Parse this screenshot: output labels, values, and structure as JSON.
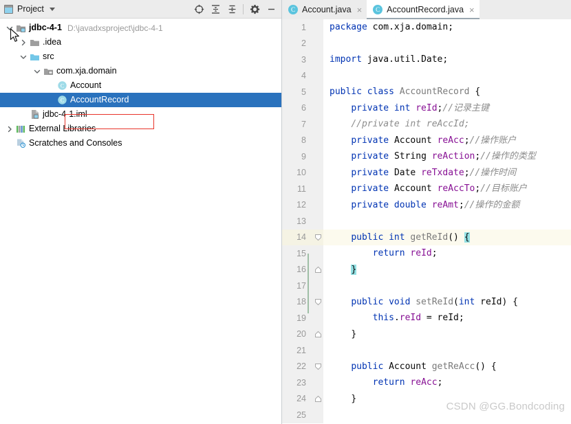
{
  "project_panel": {
    "title": "Project",
    "icons": {
      "project": "project-window-icon",
      "dropdown": "chevron-down-icon",
      "locate": "locate-target-icon",
      "expand_all": "expand-all-icon",
      "collapse_all": "collapse-all-icon",
      "settings": "gear-icon",
      "hide": "minimize-icon"
    },
    "tree": [
      {
        "label": "jdbc-4-1",
        "path": "D:\\javadxsproject\\jdbc-4-1",
        "icon": "module-icon",
        "twisty": "expanded",
        "depth": 0,
        "bold": true,
        "selected": false
      },
      {
        "label": ".idea",
        "path": "",
        "icon": "folder-gray-icon",
        "twisty": "collapsed",
        "depth": 1,
        "bold": false,
        "selected": false
      },
      {
        "label": "src",
        "path": "",
        "icon": "folder-source-icon",
        "twisty": "expanded",
        "depth": 1,
        "bold": false,
        "selected": false
      },
      {
        "label": "com.xja.domain",
        "path": "",
        "icon": "package-icon",
        "twisty": "expanded",
        "depth": 2,
        "bold": false,
        "selected": false
      },
      {
        "label": "Account",
        "path": "",
        "icon": "java-class-icon",
        "twisty": "none",
        "depth": 3,
        "bold": false,
        "selected": false
      },
      {
        "label": "AccountRecord",
        "path": "",
        "icon": "java-class-icon",
        "twisty": "none",
        "depth": 3,
        "bold": false,
        "selected": true
      },
      {
        "label": "jdbc-4-1.iml",
        "path": "",
        "icon": "iml-file-icon",
        "twisty": "none",
        "depth": 1,
        "bold": false,
        "selected": false
      },
      {
        "label": "External Libraries",
        "path": "",
        "icon": "external-libraries-icon",
        "twisty": "collapsed",
        "depth": 0,
        "bold": false,
        "selected": false
      },
      {
        "label": "Scratches and Consoles",
        "path": "",
        "icon": "scratches-icon",
        "twisty": "none",
        "depth": 0,
        "bold": false,
        "selected": false
      }
    ]
  },
  "editor": {
    "tabs": [
      {
        "label": "Account.java",
        "icon": "java-class-icon",
        "active": false,
        "close": "×"
      },
      {
        "label": "AccountRecord.java",
        "icon": "java-class-icon",
        "active": true,
        "close": "×"
      }
    ],
    "current_line": 14,
    "lines": [
      {
        "n": "1",
        "tokens": [
          {
            "t": "package ",
            "c": "k"
          },
          {
            "t": "com.xja.domain;",
            "c": "pl"
          }
        ]
      },
      {
        "n": "2",
        "tokens": []
      },
      {
        "n": "3",
        "tokens": [
          {
            "t": "import ",
            "c": "k"
          },
          {
            "t": "java.util.Date;",
            "c": "pl"
          }
        ]
      },
      {
        "n": "4",
        "tokens": []
      },
      {
        "n": "5",
        "tokens": [
          {
            "t": "public class ",
            "c": "k"
          },
          {
            "t": "AccountRecord",
            "c": "dec"
          },
          {
            "t": " {",
            "c": "pl"
          }
        ]
      },
      {
        "n": "6",
        "tokens": [
          {
            "t": "    ",
            "c": "pl"
          },
          {
            "t": "private int ",
            "c": "k"
          },
          {
            "t": "reId",
            "c": "fld"
          },
          {
            "t": ";",
            "c": "pl"
          },
          {
            "t": "//记录主键",
            "c": "cm"
          }
        ]
      },
      {
        "n": "7",
        "tokens": [
          {
            "t": "    ",
            "c": "pl"
          },
          {
            "t": "//private int reAccId;",
            "c": "cm"
          }
        ]
      },
      {
        "n": "8",
        "tokens": [
          {
            "t": "    ",
            "c": "pl"
          },
          {
            "t": "private ",
            "c": "k"
          },
          {
            "t": "Account ",
            "c": "pl"
          },
          {
            "t": "reAcc",
            "c": "fld"
          },
          {
            "t": ";",
            "c": "pl"
          },
          {
            "t": "//操作账户",
            "c": "cm"
          }
        ]
      },
      {
        "n": "9",
        "tokens": [
          {
            "t": "    ",
            "c": "pl"
          },
          {
            "t": "private ",
            "c": "k"
          },
          {
            "t": "String ",
            "c": "pl"
          },
          {
            "t": "reAction",
            "c": "fld"
          },
          {
            "t": ";",
            "c": "pl"
          },
          {
            "t": "//操作的类型",
            "c": "cm"
          }
        ]
      },
      {
        "n": "10",
        "tokens": [
          {
            "t": "    ",
            "c": "pl"
          },
          {
            "t": "private ",
            "c": "k"
          },
          {
            "t": "Date ",
            "c": "pl"
          },
          {
            "t": "reTxdate",
            "c": "fld"
          },
          {
            "t": ";",
            "c": "pl"
          },
          {
            "t": "//操作时间",
            "c": "cm"
          }
        ]
      },
      {
        "n": "11",
        "tokens": [
          {
            "t": "    ",
            "c": "pl"
          },
          {
            "t": "private ",
            "c": "k"
          },
          {
            "t": "Account ",
            "c": "pl"
          },
          {
            "t": "reAccTo",
            "c": "fld"
          },
          {
            "t": ";",
            "c": "pl"
          },
          {
            "t": "//目标账户",
            "c": "cm"
          }
        ]
      },
      {
        "n": "12",
        "tokens": [
          {
            "t": "    ",
            "c": "pl"
          },
          {
            "t": "private double ",
            "c": "k"
          },
          {
            "t": "reAmt",
            "c": "fld"
          },
          {
            "t": ";",
            "c": "pl"
          },
          {
            "t": "//操作的金额",
            "c": "cm"
          }
        ]
      },
      {
        "n": "13",
        "tokens": []
      },
      {
        "n": "14",
        "tokens": [
          {
            "t": "    ",
            "c": "pl"
          },
          {
            "t": "public int ",
            "c": "k"
          },
          {
            "t": "getReId",
            "c": "dec"
          },
          {
            "t": "() ",
            "c": "pl"
          },
          {
            "t": "{",
            "c": "pl brace-hl"
          }
        ],
        "fold": "open"
      },
      {
        "n": "15",
        "tokens": [
          {
            "t": "        ",
            "c": "pl"
          },
          {
            "t": "return ",
            "c": "k"
          },
          {
            "t": "reId",
            "c": "fld"
          },
          {
            "t": ";",
            "c": "pl"
          }
        ]
      },
      {
        "n": "16",
        "tokens": [
          {
            "t": "    ",
            "c": "pl"
          },
          {
            "t": "}",
            "c": "pl brace-hl"
          }
        ],
        "fold": "close"
      },
      {
        "n": "17",
        "tokens": []
      },
      {
        "n": "18",
        "tokens": [
          {
            "t": "    ",
            "c": "pl"
          },
          {
            "t": "public void ",
            "c": "k"
          },
          {
            "t": "setReId",
            "c": "dec"
          },
          {
            "t": "(",
            "c": "pl"
          },
          {
            "t": "int ",
            "c": "k"
          },
          {
            "t": "reId",
            "c": "pl"
          },
          {
            "t": ") {",
            "c": "pl"
          }
        ],
        "fold": "open"
      },
      {
        "n": "19",
        "tokens": [
          {
            "t": "        ",
            "c": "pl"
          },
          {
            "t": "this",
            "c": "k"
          },
          {
            "t": ".",
            "c": "pl"
          },
          {
            "t": "reId",
            "c": "fld"
          },
          {
            "t": " = reId;",
            "c": "pl"
          }
        ]
      },
      {
        "n": "20",
        "tokens": [
          {
            "t": "    ",
            "c": "pl"
          },
          {
            "t": "}",
            "c": "pl"
          }
        ],
        "fold": "close"
      },
      {
        "n": "21",
        "tokens": []
      },
      {
        "n": "22",
        "tokens": [
          {
            "t": "    ",
            "c": "pl"
          },
          {
            "t": "public ",
            "c": "k"
          },
          {
            "t": "Account ",
            "c": "pl"
          },
          {
            "t": "getReAcc",
            "c": "dec"
          },
          {
            "t": "() {",
            "c": "pl"
          }
        ],
        "fold": "open"
      },
      {
        "n": "23",
        "tokens": [
          {
            "t": "        ",
            "c": "pl"
          },
          {
            "t": "return ",
            "c": "k"
          },
          {
            "t": "reAcc",
            "c": "fld"
          },
          {
            "t": ";",
            "c": "pl"
          }
        ]
      },
      {
        "n": "24",
        "tokens": [
          {
            "t": "    ",
            "c": "pl"
          },
          {
            "t": "}",
            "c": "pl"
          }
        ],
        "fold": "close"
      },
      {
        "n": "25",
        "tokens": []
      }
    ]
  },
  "watermark": "CSDN @GG.Bondcoding",
  "colors": {
    "selection_blue": "#2a72bd",
    "annotation_red": "#e8342a",
    "keyword_blue": "#0033b3",
    "field_purple": "#871094",
    "comment_gray": "#8c8c8c",
    "brace_match_teal": "#93e0e3",
    "current_line": "#fcfaee",
    "gutter_gray": "#f0f0f0",
    "header_gray": "#ececec"
  }
}
